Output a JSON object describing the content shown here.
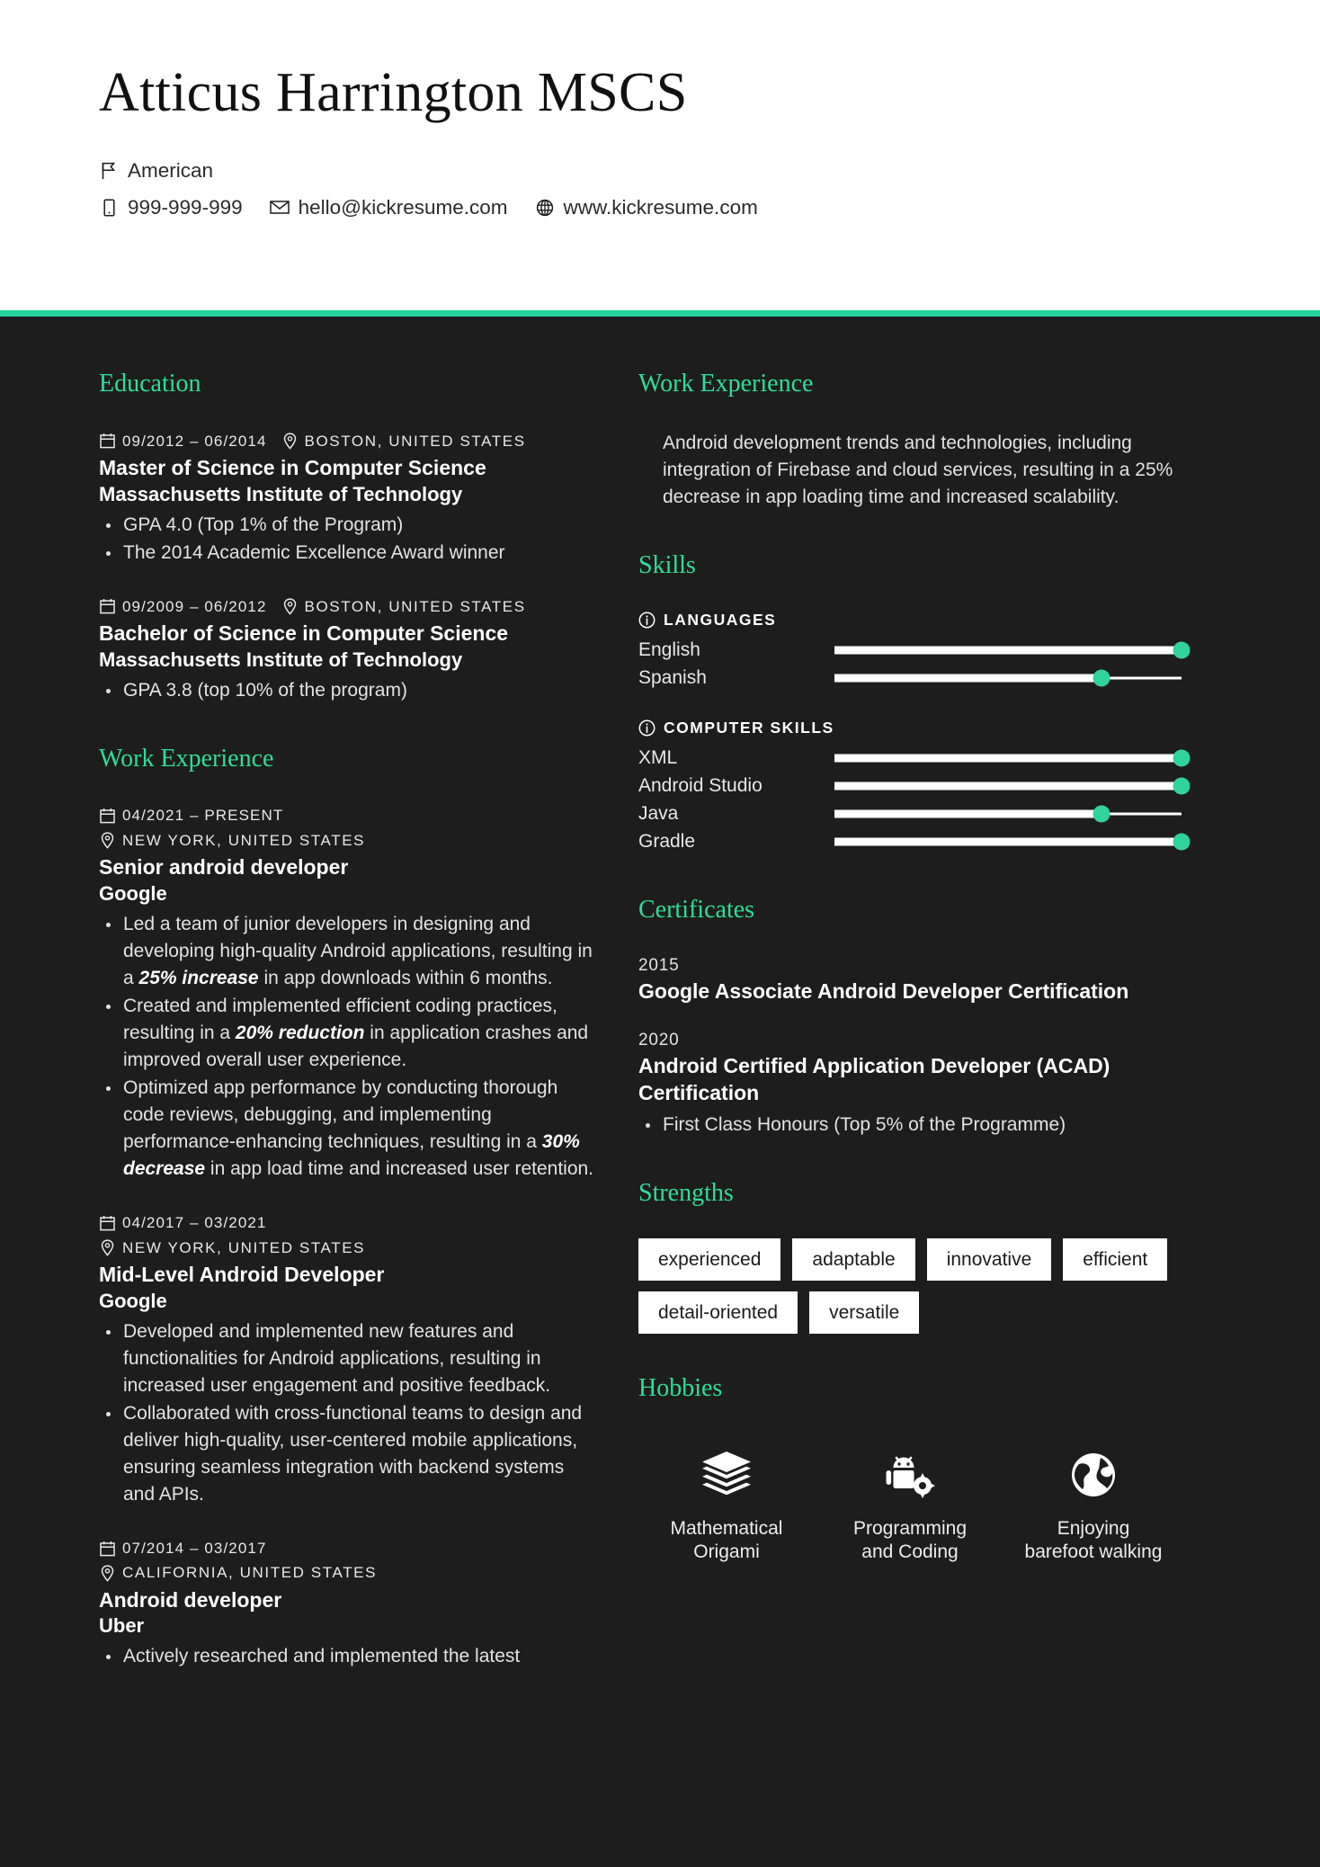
{
  "header": {
    "name": "Atticus Harrington MSCS",
    "nationality": "American",
    "phone": "999-999-999",
    "email": "hello@kickresume.com",
    "website": "www.kickresume.com",
    "accent_color": "#22d39a",
    "background_color": "#1d1d1d"
  },
  "left": {
    "education_title": "Education",
    "education": [
      {
        "dates": "09/2012 – 06/2014",
        "location": "BOSTON, UNITED STATES",
        "title": "Master of Science in Computer Science",
        "org": "Massachusetts Institute of Technology",
        "bullets": [
          "GPA 4.0 (Top 1% of the Program)",
          "The 2014 Academic Excellence Award winner"
        ]
      },
      {
        "dates": "09/2009 – 06/2012",
        "location": "BOSTON, UNITED STATES",
        "title": "Bachelor of Science in Computer Science",
        "org": "Massachusetts Institute of Technology",
        "bullets": [
          "GPA 3.8 (top 10% of the program)"
        ]
      }
    ],
    "work_title": "Work Experience",
    "work": [
      {
        "dates": "04/2021 – PRESENT",
        "location": "NEW YORK, UNITED STATES",
        "title": "Senior android developer",
        "org": "Google",
        "bullets": [
          {
            "pre": "Led a team of junior developers in designing and developing high-quality Android applications, resulting in a ",
            "em": "25% increase",
            "post": " in app downloads within 6 months."
          },
          {
            "pre": "Created and implemented efficient coding practices, resulting in a ",
            "em": "20% reduction",
            "post": " in application crashes and improved overall user experience."
          },
          {
            "pre": "Optimized app performance by conducting thorough code reviews, debugging, and implementing performance-enhancing techniques, resulting in a ",
            "em": "30% decrease",
            "post": " in app load time and increased user retention."
          }
        ]
      },
      {
        "dates": "04/2017 – 03/2021",
        "location": "NEW YORK, UNITED STATES",
        "title": "Mid-Level Android Developer",
        "org": "Google",
        "bullets": [
          {
            "pre": "Developed and implemented new features and functionalities for Android applications, resulting in increased user engagement and positive feedback.",
            "em": "",
            "post": ""
          },
          {
            "pre": "Collaborated with cross-functional teams to design and deliver high-quality, user-centered mobile applications, ensuring seamless integration with backend systems and APIs.",
            "em": "",
            "post": ""
          }
        ]
      },
      {
        "dates": "07/2014 – 03/2017",
        "location": "CALIFORNIA, UNITED STATES",
        "title": "Android developer",
        "org": "Uber",
        "bullets": [
          {
            "pre": "Actively researched and implemented the latest",
            "em": "",
            "post": ""
          }
        ]
      }
    ]
  },
  "right": {
    "work_title": "Work Experience",
    "work_continuation": "Android development trends and technologies, including integration of Firebase and cloud services, resulting in a 25% decrease in app loading time and increased scalability.",
    "skills_title": "Skills",
    "skill_groups": [
      {
        "label": "LANGUAGES",
        "items": [
          {
            "name": "English",
            "level": 100
          },
          {
            "name": "Spanish",
            "level": 77
          }
        ]
      },
      {
        "label": "COMPUTER SKILLS",
        "items": [
          {
            "name": "XML",
            "level": 100
          },
          {
            "name": "Android Studio",
            "level": 100
          },
          {
            "name": "Java",
            "level": 77
          },
          {
            "name": "Gradle",
            "level": 100
          }
        ]
      }
    ],
    "certificates_title": "Certificates",
    "certificates": [
      {
        "year": "2015",
        "name": "Google Associate Android Developer Certification",
        "bullets": []
      },
      {
        "year": "2020",
        "name": "Android Certified Application Developer (ACAD) Certification",
        "bullets": [
          "First Class Honours (Top 5% of the Programme)"
        ]
      }
    ],
    "strengths_title": "Strengths",
    "strengths": [
      "experienced",
      "adaptable",
      "innovative",
      "efficient",
      "detail-oriented",
      "versatile"
    ],
    "hobbies_title": "Hobbies",
    "hobbies": [
      {
        "icon": "layers-icon",
        "label": "Mathematical Origami"
      },
      {
        "icon": "android-gear-icon",
        "label": "Programming and Coding"
      },
      {
        "icon": "globe-earth-icon",
        "label": "Enjoying barefoot walking"
      }
    ]
  }
}
